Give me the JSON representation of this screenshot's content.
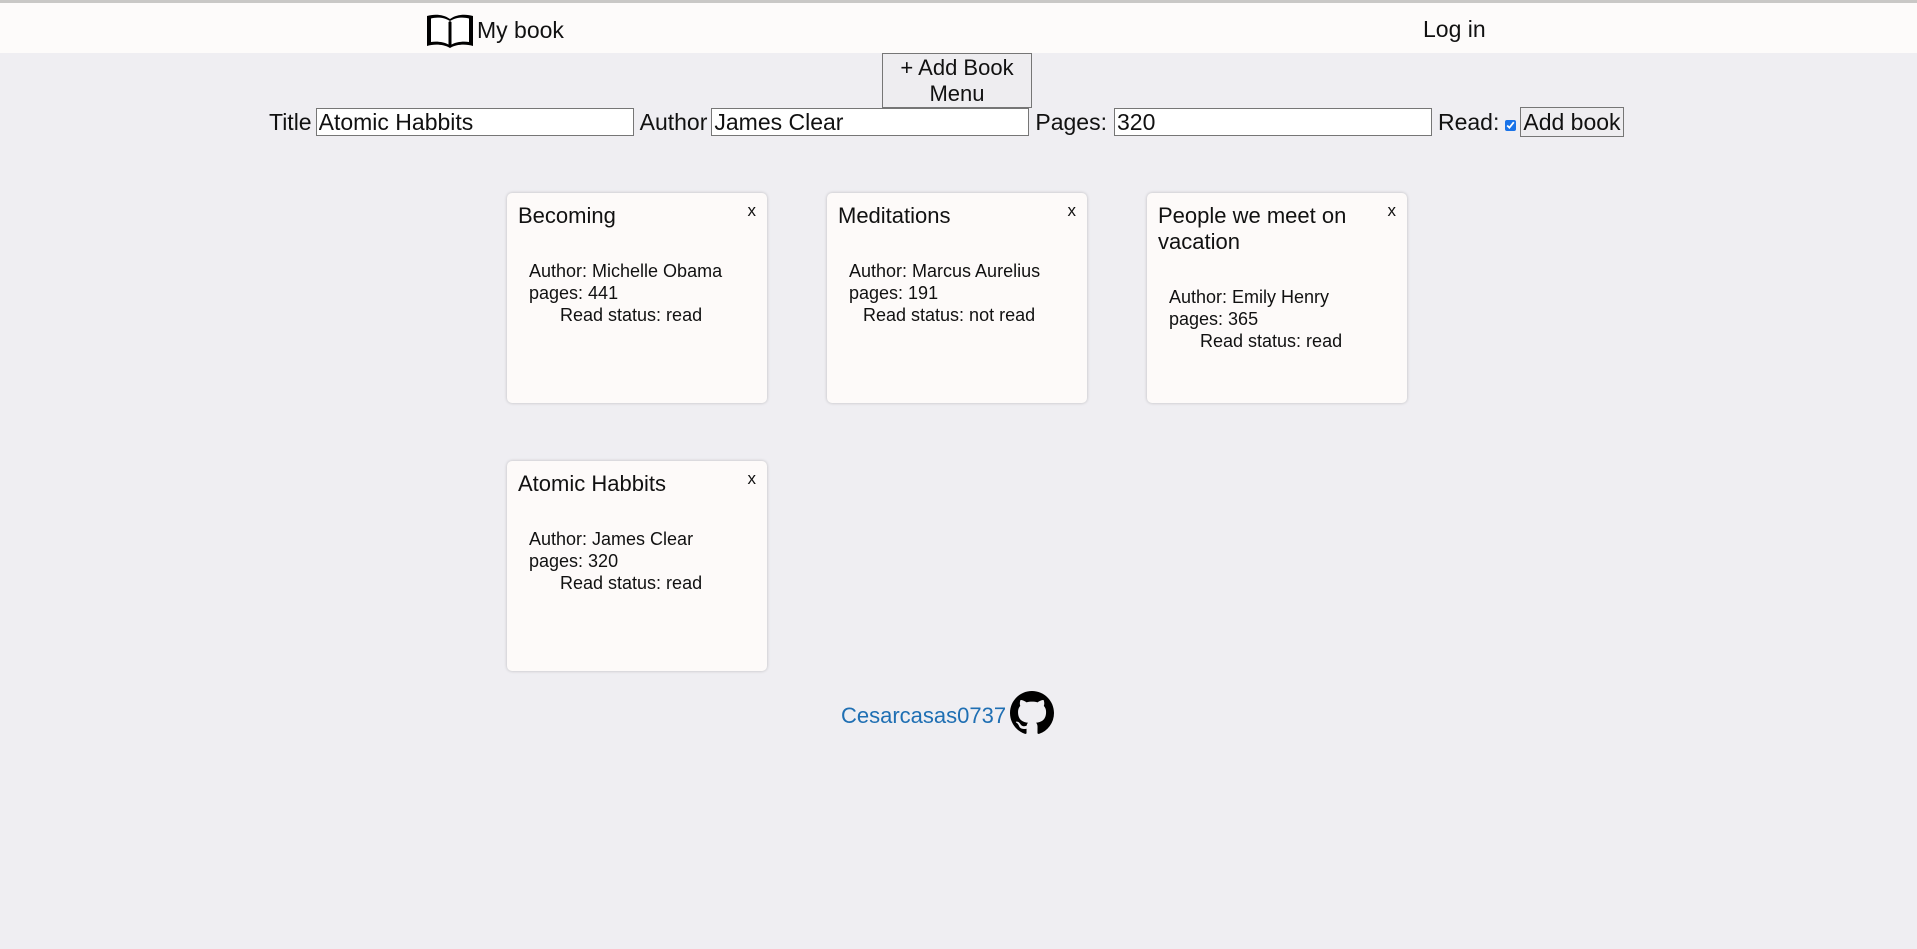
{
  "header": {
    "brand_icon": "open-book-icon",
    "brand_label": "My book",
    "login_label": "Log in"
  },
  "add_menu_button": {
    "label_line1": "+ Add Book",
    "label_line2": "Menu"
  },
  "form": {
    "title_label": "Title",
    "title_value": "Atomic Habbits",
    "author_label": "Author",
    "author_value": "James Clear",
    "pages_label": "Pages:",
    "pages_value": "320",
    "read_label": "Read:",
    "read_checked": true,
    "add_book_label": "Add book"
  },
  "books": [
    {
      "title": "Becoming",
      "author": "Author: Michelle Obama",
      "pages": "pages: 441",
      "status": "Read status: read",
      "close": "x"
    },
    {
      "title": "Meditations",
      "author": "Author: Marcus Aurelius",
      "pages": "pages: 191",
      "status": "Read status: not read",
      "close": "x"
    },
    {
      "title": "People we meet on vacation",
      "author": "Author: Emily Henry",
      "pages": "pages: 365",
      "status": "Read status: read",
      "close": "x"
    },
    {
      "title": "Atomic Habbits",
      "author": "Author: James Clear",
      "pages": "pages: 320",
      "status": "Read status: read",
      "close": "x"
    }
  ],
  "footer": {
    "link_label": "Cesarcasas0737",
    "icon": "github-icon"
  },
  "colors": {
    "background": "#efeef2",
    "header_bg": "#fdfbfa",
    "card_bg": "#fdfaf9",
    "link": "#1f6fb3",
    "checkbox_accent": "#1a73e8"
  }
}
